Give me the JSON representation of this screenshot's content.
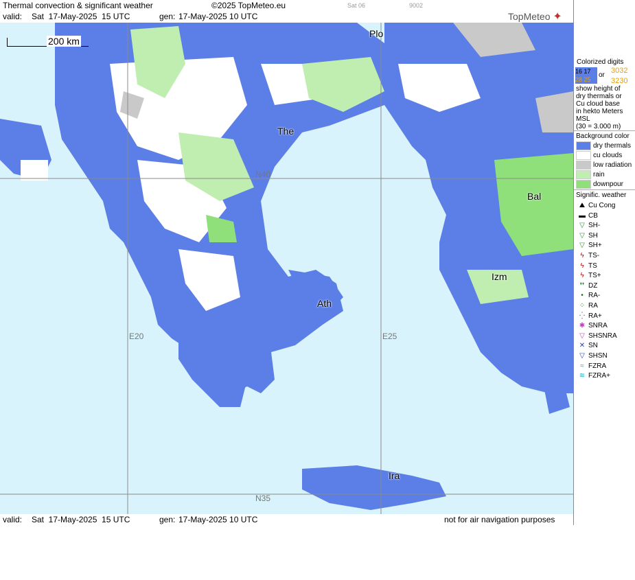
{
  "header": {
    "title": "Thermal convection & significant weather",
    "copyright": "©2025 TopMeteo.eu",
    "frame": "Sat 06",
    "code": "9002",
    "valid_label": "valid:",
    "valid_value": "Sat  17-May-2025  15 UTC",
    "gen_label": "gen:",
    "gen_value": "17-May-2025 10 UTC"
  },
  "logo": {
    "text": "TopMeteo",
    "icon": "compass-star-icon"
  },
  "footer": {
    "valid_label": "valid:",
    "valid_value": "Sat  17-May-2025  15 UTC",
    "gen_label": "gen:",
    "gen_value": "17-May-2025 10 UTC",
    "disclaimer": "not for air navigation purposes"
  },
  "map": {
    "scale_label": "200 km",
    "cities": [
      "Plo",
      "The",
      "Bal",
      "Izm",
      "Ath",
      "Ira"
    ],
    "grid_labels": {
      "lat40": "N40",
      "lat35": "N35",
      "lon20": "E20",
      "lon25": "E25"
    },
    "colors": {
      "sea": "#d8f3fb",
      "dry_thermals": "#5b7fe6",
      "cu_clouds": "#ffffff",
      "low_radiation": "#c9c9c9",
      "rain": "#bfeeb0",
      "downpour": "#8fe07a"
    }
  },
  "legend": {
    "title_lines": [
      "Colorized digits"
    ],
    "sample_a": "16 17",
    "sample_b": "28 25",
    "sample_or": "or",
    "sample_c": "3032",
    "sample_d": "3230",
    "desc_lines": [
      "show height of",
      "dry thermals or",
      "Cu cloud base",
      "in hekto Meters",
      "MSL",
      "(30 = 3.000 m)"
    ],
    "bg_title": "Background color",
    "bg_items": [
      {
        "label": "dry thermals",
        "color": "#5b7fe6"
      },
      {
        "label": "cu clouds",
        "color": "#ffffff"
      },
      {
        "label": "low radiation",
        "color": "#c9c9c9"
      },
      {
        "label": "rain",
        "color": "#bfeeb0"
      },
      {
        "label": "downpour",
        "color": "#8fe07a"
      }
    ],
    "wx_title": "Signific. weather",
    "wx_items": [
      {
        "label": "Cu Cong",
        "glyph": "⛰",
        "color": "#000"
      },
      {
        "label": "CB",
        "glyph": "▬",
        "color": "#000"
      },
      {
        "label": "SH-",
        "glyph": "▽",
        "color": "#2a8a2a"
      },
      {
        "label": "SH",
        "glyph": "▽",
        "color": "#2a8a2a"
      },
      {
        "label": "SH+",
        "glyph": "▽",
        "color": "#2a8a2a"
      },
      {
        "label": "TS-",
        "glyph": "ϟ",
        "color": "#cc0000"
      },
      {
        "label": "TS",
        "glyph": "ϟ",
        "color": "#cc0000"
      },
      {
        "label": "TS+",
        "glyph": "ϟ",
        "color": "#cc0000"
      },
      {
        "label": "DZ",
        "glyph": "❜❜",
        "color": "#1a6b1a"
      },
      {
        "label": "RA-",
        "glyph": "•",
        "color": "#1a6b1a"
      },
      {
        "label": "RA",
        "glyph": "⁘",
        "color": "#1a6b1a"
      },
      {
        "label": "RA+",
        "glyph": "⁛",
        "color": "#1a6b1a"
      },
      {
        "label": "SNRA",
        "glyph": "✱",
        "color": "#c040c0"
      },
      {
        "label": "SHSNRA",
        "glyph": "▽",
        "color": "#c040c0"
      },
      {
        "label": "SN",
        "glyph": "✕",
        "color": "#2040c0"
      },
      {
        "label": "SHSN",
        "glyph": "▽",
        "color": "#2040c0"
      },
      {
        "label": "FZRA",
        "glyph": "≈",
        "color": "#20b0c0"
      },
      {
        "label": "FZRA+",
        "glyph": "≋",
        "color": "#20b0c0"
      }
    ]
  }
}
